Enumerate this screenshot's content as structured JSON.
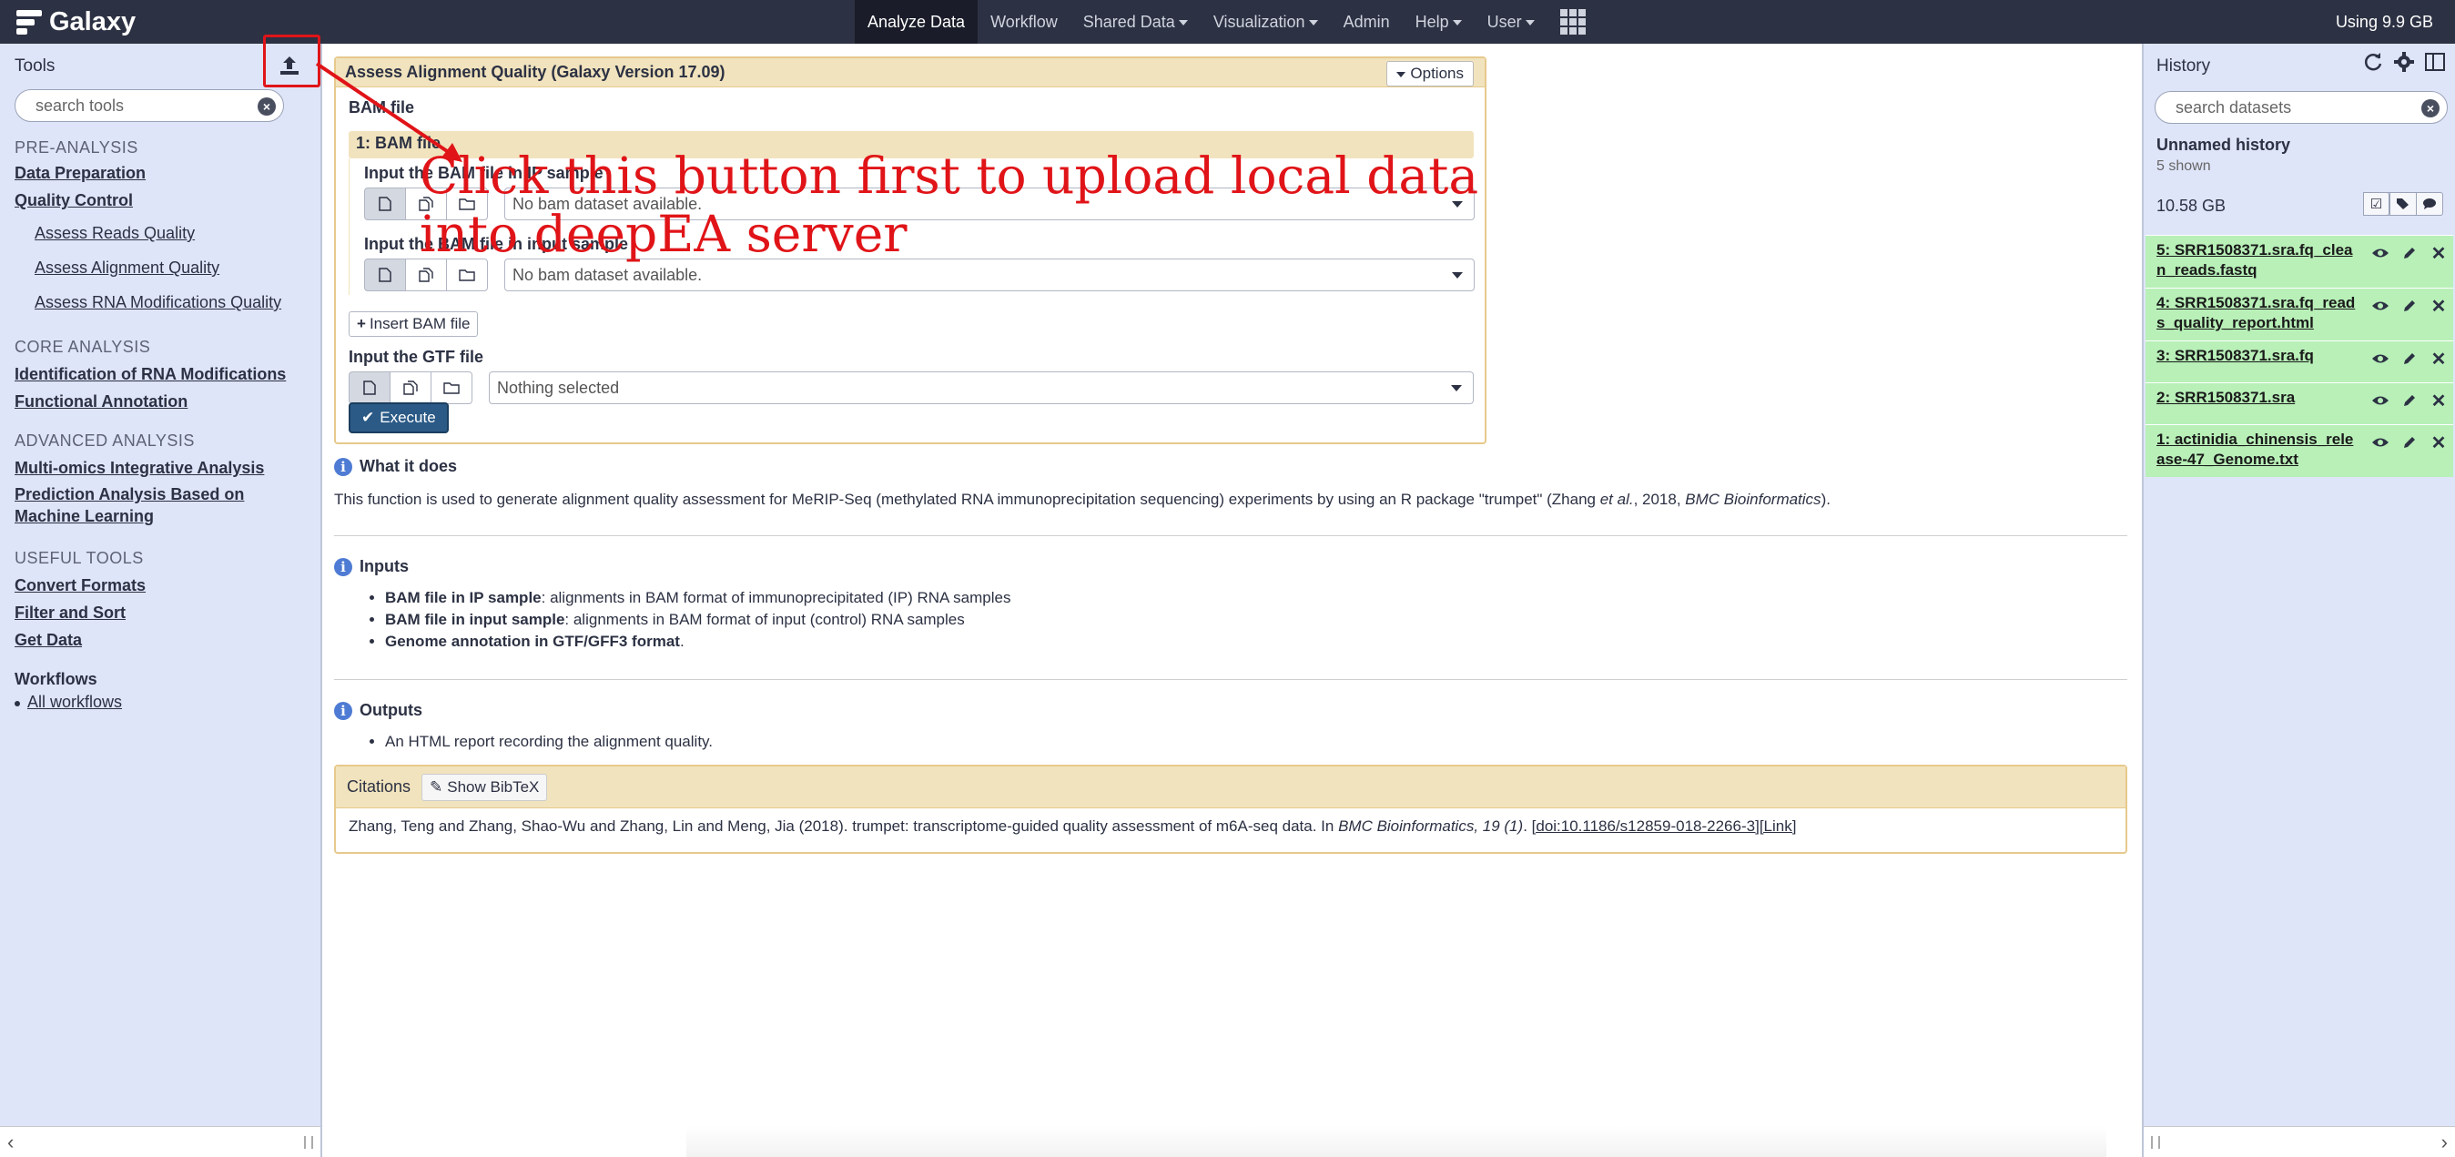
{
  "masthead": {
    "brand": "Galaxy",
    "nav": [
      {
        "label": "Analyze Data",
        "active": true,
        "dropdown": false
      },
      {
        "label": "Workflow",
        "active": false,
        "dropdown": false
      },
      {
        "label": "Shared Data",
        "active": false,
        "dropdown": true
      },
      {
        "label": "Visualization",
        "active": false,
        "dropdown": true
      },
      {
        "label": "Admin",
        "active": false,
        "dropdown": false
      },
      {
        "label": "Help",
        "active": false,
        "dropdown": true
      },
      {
        "label": "User",
        "active": false,
        "dropdown": true
      }
    ],
    "usage": "Using 9.9 GB"
  },
  "tools": {
    "title": "Tools",
    "search_placeholder": "search tools",
    "sections": {
      "pre": {
        "title": "PRE-ANALYSIS",
        "data_prep": "Data Preparation",
        "qc": "Quality Control",
        "sub": [
          "Assess Reads Quality",
          "Assess Alignment Quality",
          "Assess RNA Modifications Quality"
        ]
      },
      "core": {
        "title": "CORE ANALYSIS",
        "items": [
          "Identification of RNA Modifications",
          "Functional Annotation"
        ]
      },
      "advanced": {
        "title": "ADVANCED ANALYSIS",
        "items": [
          "Multi-omics Integrative Analysis",
          "Prediction Analysis Based on",
          "Machine Learning"
        ]
      },
      "useful": {
        "title": "USEFUL TOOLS",
        "items": [
          "Convert Formats",
          "Filter and Sort",
          "Get Data"
        ]
      }
    },
    "workflows": {
      "title": "Workflows",
      "all": "All workflows"
    }
  },
  "form": {
    "title": "Assess Alignment Quality (Galaxy Version 17.09)",
    "options": "Options",
    "bam_label": "BAM file",
    "repeat_title": "1: BAM file",
    "ip_label": "Input the BAM file in IP sample",
    "ip_value": "No bam dataset available.",
    "input_label": "Input the BAM file in input sample",
    "input_value": "No bam dataset available.",
    "insert_label": "Insert BAM file",
    "gtf_label": "Input the GTF file",
    "gtf_value": "Nothing selected",
    "execute": "Execute"
  },
  "help": {
    "what_title": "What it does",
    "what_pre": "This function is used to generate alignment quality assessment for MeRIP-Seq (methylated RNA immunoprecipitation sequencing) experiments by using an R package \"trumpet\" (Zhang ",
    "what_etal": "et al.",
    "what_mid": ", 2018, ",
    "what_journal": "BMC Bioinformatics",
    "what_end": ").",
    "inputs_title": "Inputs",
    "inputs": [
      {
        "bold": "BAM file in IP sample",
        "rest": ": alignments in BAM format of immunoprecipitated (IP) RNA samples"
      },
      {
        "bold": "BAM file in input sample",
        "rest": ": alignments in BAM format of input (control) RNA samples"
      },
      {
        "bold": "Genome annotation in GTF/GFF3 format",
        "rest": "."
      }
    ],
    "outputs_title": "Outputs",
    "outputs": [
      "An HTML report recording the alignment quality."
    ]
  },
  "citations": {
    "title": "Citations",
    "bibtex": "Show BibTeX",
    "text_pre": "Zhang, Teng and Zhang, Shao-Wu and Zhang, Lin and Meng, Jia (2018). trumpet: transcriptome-guided quality assessment of m6A-seq data. In ",
    "journal": "BMC Bioinformatics, 19 (1)",
    "dot": ". ",
    "doi": "[doi:10.1186/s12859-018-2266-3]",
    "link": "[Link]"
  },
  "annotation": {
    "text": "Click this button first to upload local data into deepEA server",
    "color": "#e01418"
  },
  "history": {
    "title": "History",
    "search_placeholder": "search datasets",
    "name": "Unnamed history",
    "shown": "5 shown",
    "size": "10.58 GB",
    "datasets": [
      "5: SRR1508371.sra.fq_clean_reads.fastq",
      "4: SRR1508371.sra.fq_reads_quality_report.html",
      "3: SRR1508371.sra.fq",
      "2: SRR1508371.sra",
      "1: actinidia_chinensis_release-47_Genome.txt"
    ]
  },
  "colors": {
    "masthead": "#2c3143",
    "panel": "#dfe5f9",
    "ok_dataset": "#b8f0b8",
    "form_header": "#f1e3bd",
    "execute": "#2b5a86"
  }
}
